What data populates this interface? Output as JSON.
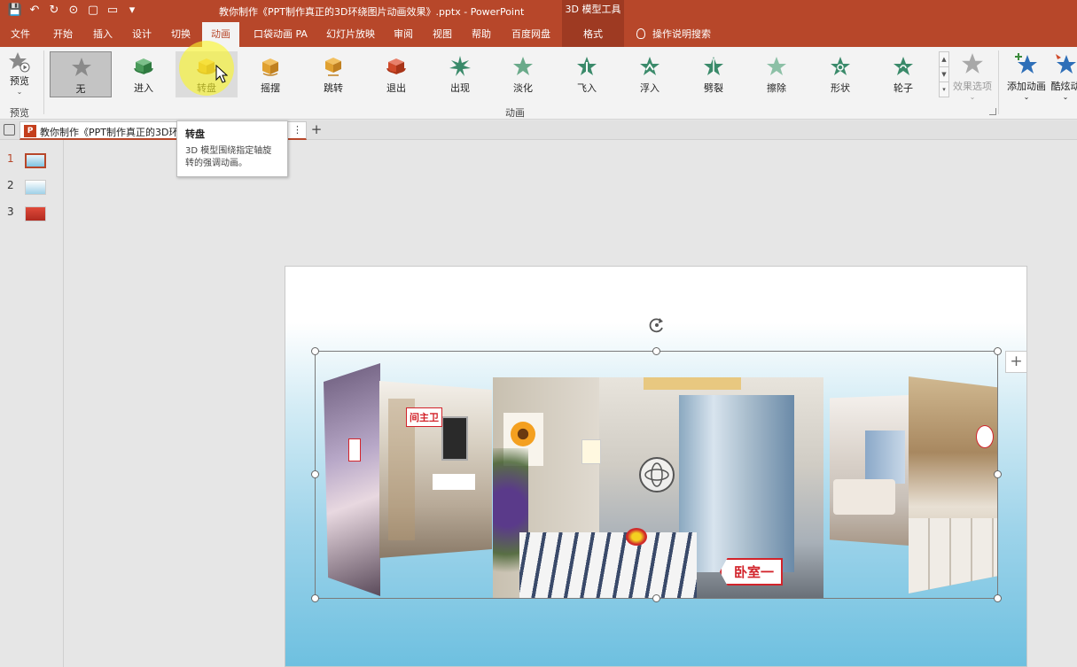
{
  "window": {
    "title": "教你制作《PPT制作真正的3D环绕图片动画效果》.pptx  -  PowerPoint",
    "context_tool": "3D 模型工具"
  },
  "tabs": [
    {
      "label": "文件"
    },
    {
      "label": "开始"
    },
    {
      "label": "插入"
    },
    {
      "label": "设计"
    },
    {
      "label": "切换"
    },
    {
      "label": "动画"
    },
    {
      "label": "口袋动画 PA"
    },
    {
      "label": "幻灯片放映"
    },
    {
      "label": "审阅"
    },
    {
      "label": "视图"
    },
    {
      "label": "帮助"
    },
    {
      "label": "百度网盘"
    },
    {
      "label": "格式"
    }
  ],
  "tellme": "操作说明搜索",
  "ribbon": {
    "preview_label": "预览",
    "preview_group": "预览",
    "animation_group": "动画",
    "gallery": [
      {
        "label": "无",
        "icon": "star-gray-icon",
        "color": "#8a8a8a"
      },
      {
        "label": "进入",
        "icon": "3d-cube-green-icon",
        "color": "#4a9a5a"
      },
      {
        "label": "转盘",
        "icon": "3d-cube-turntable-icon",
        "color": "#e0a030"
      },
      {
        "label": "摇摆",
        "icon": "3d-cube-swing-icon",
        "color": "#e0a030"
      },
      {
        "label": "跳转",
        "icon": "3d-cube-jump-icon",
        "color": "#e0a030"
      },
      {
        "label": "退出",
        "icon": "3d-cube-exit-icon",
        "color": "#d04a2a"
      },
      {
        "label": "出现",
        "icon": "star-burst-icon",
        "color": "#3a8a6a"
      },
      {
        "label": "淡化",
        "icon": "star-fade-icon",
        "color": "#6aaa8a"
      },
      {
        "label": "飞入",
        "icon": "star-fly-icon",
        "color": "#3a8a6a"
      },
      {
        "label": "浮入",
        "icon": "star-float-icon",
        "color": "#3a8a6a"
      },
      {
        "label": "劈裂",
        "icon": "star-split-icon",
        "color": "#3a8a6a"
      },
      {
        "label": "擦除",
        "icon": "star-wipe-icon",
        "color": "#6aaa8a"
      },
      {
        "label": "形状",
        "icon": "star-shape-icon",
        "color": "#3a8a6a"
      },
      {
        "label": "轮子",
        "icon": "star-wheel-icon",
        "color": "#3a8a6a"
      }
    ],
    "effect_options": "效果选项",
    "add_animation": "添加动画",
    "animation_pane": "酷炫动"
  },
  "doc_tab": {
    "name": "教你制作《PPT制作真正的3D环",
    "more": "⋮",
    "new_tab": "+"
  },
  "tooltip": {
    "title": "转盘",
    "body": "3D 模型围绕指定轴旋转的强调动画。"
  },
  "slides": [
    {
      "num": "1",
      "active": true
    },
    {
      "num": "2",
      "active": false
    },
    {
      "num": "3",
      "active": false
    }
  ],
  "slide_content": {
    "sign_left": "间主卫",
    "sign_center": "卧室一"
  }
}
